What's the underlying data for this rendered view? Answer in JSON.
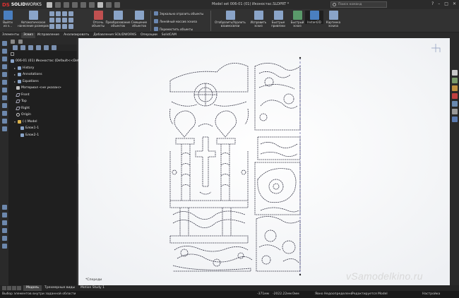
{
  "app": {
    "brand_ds": "DS",
    "brand_name": "SOLID",
    "brand_light": "WORKS"
  },
  "window": {
    "title": "Model set 006-01 (01) Иконостас.SLDPRT *"
  },
  "search": {
    "placeholder": "Поиск команд"
  },
  "window_controls": [
    "?",
    "–",
    "□",
    "✕"
  ],
  "ribbon": {
    "exit_sketch": "Выйти из э...",
    "smart_dim": "Автоматическое нанесение размеров",
    "trim": "Отсечь объекты",
    "convert": "Преобразование объектов",
    "offset": "Смещение объектов",
    "mirror": "Зеркально отразить объекты",
    "linear_pattern": "Линейный массив эскиза",
    "move": "Переместить объекты",
    "show_relations": "Отобразить/Удалить взаимосвязи",
    "repair": "Исправить эскиз",
    "quick_snaps": "Быстрые привязки",
    "rapid_sketch": "Быстрый эскиз",
    "instant2d": "Instant2D",
    "shaded": "Картинка эскиза"
  },
  "command_tabs": [
    "Элементы",
    "Эскиз",
    "Исправление",
    "Анализировать",
    "Добавления SOLIDWORKS",
    "Операции",
    "SolidCAM"
  ],
  "active_command_tab": "Эскиз",
  "feature_tree": {
    "root": "006-01 (01) Иконостас  (Default<<Defa...",
    "items": [
      {
        "label": "History",
        "icon": "history-icon"
      },
      {
        "label": "Annotations",
        "icon": "annotations-icon"
      },
      {
        "label": "Equations",
        "icon": "equations-icon"
      },
      {
        "label": "Материал <не указан>",
        "icon": "material-icon"
      },
      {
        "label": "Front",
        "icon": "plane-icon"
      },
      {
        "label": "Top",
        "icon": "plane-icon"
      },
      {
        "label": "Right",
        "icon": "plane-icon"
      },
      {
        "label": "Origin",
        "icon": "origin-icon"
      },
      {
        "label": "(-) Model",
        "icon": "sketch-icon"
      },
      {
        "label": "Блок1-1",
        "icon": "block-icon"
      },
      {
        "label": "Блок2-1",
        "icon": "block-icon"
      }
    ]
  },
  "viewport": {
    "view_label": "*Спереди"
  },
  "bottom_tabs": [
    "Модель",
    "Трехмерные виды",
    "Motion Study 1"
  ],
  "active_bottom_tab": "Модель",
  "status": {
    "left": "Выбор элементов внутри заданной области",
    "x": "-371мм",
    "y": "-2022.22мм",
    "z": "0мм",
    "state": "Явно Недоопределено",
    "editing": "Редактируется Model",
    "settings": "Настройка"
  },
  "watermark": "vSamodelkino.ru",
  "colors": {
    "accent_red": "#e03030",
    "ribbon_bg": "#323232",
    "canvas_bg": "#ffffff",
    "sketch_line": "#3a3a4a"
  }
}
